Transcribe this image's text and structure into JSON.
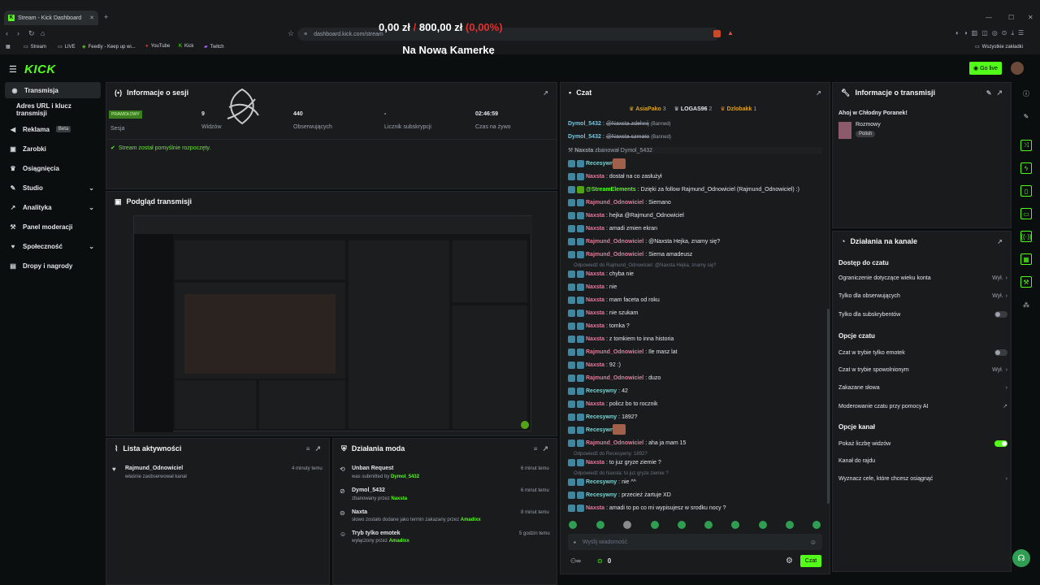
{
  "browser": {
    "tab_title": "Stream - Kick Dashboard",
    "url": "dashboard.kick.com/stream",
    "bookmarks": [
      "Stream",
      "LIVE",
      "Feedly - Keep up wi...",
      "YouTube",
      "Kick",
      "Twitch"
    ],
    "all_bookmarks": "Wszystkie zakładki"
  },
  "overlay": {
    "money_a": "0,00 zł",
    "sep": "/",
    "money_b": "800,00 zł",
    "pct": "(0,00%)",
    "title": "Na Nową Kamerkę"
  },
  "header": {
    "logo": "KICK",
    "go_live": "Go live"
  },
  "sidebar": {
    "items": [
      {
        "label": "Transmisja"
      },
      {
        "label": "Adres URL i klucz transmisji"
      },
      {
        "label": "Reklama",
        "badge": "Beta"
      },
      {
        "label": "Zarobki"
      },
      {
        "label": "Osiągnięcia"
      },
      {
        "label": "Studio"
      },
      {
        "label": "Analityka"
      },
      {
        "label": "Panel moderacji"
      },
      {
        "label": "Społeczność"
      },
      {
        "label": "Dropy i nagrody"
      }
    ]
  },
  "session": {
    "title": "Informacje o sesji",
    "badge": "PRAWIDŁOWY",
    "stats": [
      {
        "value": "",
        "label": "Sesja"
      },
      {
        "value": "9",
        "label": "Widzów"
      },
      {
        "value": "440",
        "label": "Obserwujących"
      },
      {
        "value": "-",
        "label": "Licznik subskrypcji"
      },
      {
        "value": "02:46:59",
        "label": "Czas na żywo"
      }
    ],
    "status": "Stream został pomyślnie rozpoczęty."
  },
  "preview": {
    "title": "Podgląd transmisji"
  },
  "activity": {
    "title": "Lista aktywności",
    "items": [
      {
        "name": "Rajmund_Odnowiciel",
        "time": "4 minuty temu",
        "desc": "właśnie zaobserwował kanał"
      }
    ]
  },
  "modactions": {
    "title": "Działania moda",
    "items": [
      {
        "title": "Unban Request",
        "sub": "was submitted by",
        "user": "Dymol_5432",
        "time": "6 minut temu"
      },
      {
        "title": "Dymol_5432",
        "sub": "zbanowany przez",
        "user": "Naxsta",
        "time": "6 minut temu"
      },
      {
        "title": "Naxta",
        "sub": "słowo zostało dodane jako termin zakazany przez",
        "user": "Amadixx",
        "time": "8 minut temu"
      },
      {
        "title": "Tryb tylko emotek",
        "sub": "wyłączony przez",
        "user": "Amadixx",
        "time": "5 godzin temu"
      }
    ]
  },
  "chat": {
    "title": "Czat",
    "top": [
      {
        "name": "AsiaPako",
        "n": "3"
      },
      {
        "name": "LOGAS96",
        "n": "2"
      },
      {
        "name": "Dzlobakk",
        "n": "1"
      }
    ],
    "lines": [
      {
        "user": "Dymol_5432",
        "text": "@Naxsta zdehnij",
        "extra": "(Banned)",
        "uc": "u-blue",
        "strike": true
      },
      {
        "user": "Dymol_5432",
        "text": "@Naxsta szmato",
        "extra": "(Banned)",
        "uc": "u-blue",
        "strike": true
      },
      {
        "user": "Naxsta",
        "text": "zbanował Dymol_5432",
        "extra": "",
        "uc": "sys",
        "strike": false
      },
      {
        "user": "Recesywny",
        "text": "",
        "extra": "",
        "uc": "u-teal",
        "strike": false
      },
      {
        "user": "Naxsta",
        "text": "dostał na co zasłużył",
        "extra": "",
        "uc": "u-pink",
        "strike": false
      },
      {
        "user": "@StreamElements",
        "text": "Dzięki za follow Rajmund_Odnowiciel (Rajmund_Odnowiciel) :)",
        "extra": "",
        "uc": "u-green",
        "strike": false
      },
      {
        "user": "Rajmund_Odnowiciel",
        "text": "Siemano",
        "extra": "",
        "uc": "u-pink",
        "strike": false
      },
      {
        "user": "Naxsta",
        "text": "hejka @Rajmund_Odnowiciel",
        "extra": "",
        "uc": "u-pink",
        "strike": false
      },
      {
        "user": "Naxsta",
        "text": "amadi zmien ekran",
        "extra": "",
        "uc": "u-pink",
        "strike": false
      },
      {
        "user": "Rajmund_Odnowiciel",
        "text": "@Naxsta Hejka, znamy się?",
        "extra": "",
        "uc": "u-pink",
        "strike": false
      },
      {
        "user": "Rajmund_Odnowiciel",
        "text": "Siema amadeusz",
        "extra": "",
        "uc": "u-pink",
        "strike": false
      },
      {
        "user": "Naxsta",
        "text": "chyba nie",
        "extra": "",
        "uc": "u-pink",
        "strike": false
      },
      {
        "user": "Naxsta",
        "text": "nie",
        "extra": "",
        "uc": "u-pink",
        "strike": false
      },
      {
        "user": "Naxsta",
        "text": "mam faceta od roku",
        "extra": "",
        "uc": "u-pink",
        "strike": false
      },
      {
        "user": "Naxsta",
        "text": "nie szukam",
        "extra": "",
        "uc": "u-pink",
        "strike": false
      },
      {
        "user": "Naxsta",
        "text": "tomka ?",
        "extra": "",
        "uc": "u-pink",
        "strike": false
      },
      {
        "user": "Naxsta",
        "text": "z tomkiem to inna historia",
        "extra": "",
        "uc": "u-pink",
        "strike": false
      },
      {
        "user": "Rajmund_Odnowiciel",
        "text": "Ile masz lat",
        "extra": "",
        "uc": "u-pink",
        "strike": false
      },
      {
        "user": "Naxsta",
        "text": "92 :)",
        "extra": "",
        "uc": "u-pink",
        "strike": false
      },
      {
        "user": "Rajmund_Odnowiciel",
        "text": "duzo",
        "extra": "",
        "uc": "u-pink",
        "strike": false
      },
      {
        "user": "Recesywny",
        "text": "42",
        "extra": "",
        "uc": "u-teal",
        "strike": false
      },
      {
        "user": "Naxsta",
        "text": "policz bo to rocznik",
        "extra": "",
        "uc": "u-pink",
        "strike": false
      },
      {
        "user": "Recesywny",
        "text": "1892?",
        "extra": "",
        "uc": "u-teal",
        "strike": false
      },
      {
        "user": "Recesywny",
        "text": "",
        "extra": "",
        "uc": "u-teal",
        "strike": false
      },
      {
        "user": "Rajmund_Odnowiciel",
        "text": "aha ja mam 15",
        "extra": "",
        "uc": "u-pink",
        "strike": false
      },
      {
        "user": "Naxsta",
        "text": "to juz gryze ziemie ?",
        "extra": "",
        "uc": "u-pink",
        "strike": false
      },
      {
        "user": "Recesywny",
        "text": "nie ^^",
        "extra": "",
        "uc": "u-teal",
        "strike": false
      },
      {
        "user": "Recesywny",
        "text": "przecież żartuje XD",
        "extra": "",
        "uc": "u-teal",
        "strike": false
      },
      {
        "user": "Naxsta",
        "text": "amadi to po co mi wypisujesz w srodku nocy ?",
        "extra": "",
        "uc": "u-pink",
        "strike": false
      }
    ],
    "replies": [
      "Odpowiedź do Rajmund_Odnowiciel: @Naxsta Hejka, znamy się?",
      "Odpowiedź do Recesywny: 1892?",
      "Odpowiedź do Naxsta: to juz gryze ziemie ?"
    ],
    "input_placeholder": "Wyślij wiadomość",
    "count": "0",
    "send": "Czat"
  },
  "streaminfo": {
    "title": "Informacje o transmisji",
    "stream_title": "Ahoj w Chłodny Poranek!",
    "category": "Rozmowy",
    "lang": "Polish"
  },
  "channel": {
    "title": "Działania na kanale",
    "sections": [
      {
        "title": "Dostęp do czatu",
        "rows": [
          {
            "label": "Ograniczenie dotyczące wieku konta",
            "val": "Wył."
          },
          {
            "label": "Tylko dla obserwujących",
            "val": "Wył."
          },
          {
            "label": "Tylko dla subskrybentów",
            "val": ""
          }
        ]
      },
      {
        "title": "Opcje czatu",
        "rows": [
          {
            "label": "Czat w trybie tylko emotek",
            "val": ""
          },
          {
            "label": "Czat w trybie spowolnionym",
            "val": "Wył."
          },
          {
            "label": "Zakazane słowa",
            "val": ""
          },
          {
            "label": "Moderowanie czatu przy pomocy AI",
            "val": ""
          }
        ]
      },
      {
        "title": "Opcje kanał",
        "rows": [
          {
            "label": "Pokaż liczbę widzów",
            "val": ""
          },
          {
            "label": "Kanał do rajdu",
            "val": ""
          },
          {
            "label": "Wyznacz cele, które chcesz osiągnąć",
            "val": ""
          }
        ]
      }
    ]
  }
}
